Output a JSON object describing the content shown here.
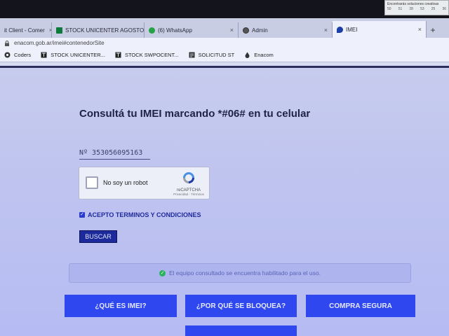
{
  "notification": {
    "text": "Encontrarás soluciones creativas",
    "numbers": [
      "50",
      "51",
      "28",
      "53",
      "25",
      "36"
    ]
  },
  "tabs": [
    {
      "label": "it Client - Comer",
      "active": false
    },
    {
      "label": "STOCK UNICENTER AGOSTO",
      "active": false
    },
    {
      "label": "(6) WhatsApp",
      "active": false
    },
    {
      "label": "Admin",
      "active": false
    },
    {
      "label": "IMEI",
      "active": true
    }
  ],
  "address": {
    "url": "enacom.gob.ar/imei#contenedorSite"
  },
  "bookmarks": [
    {
      "label": "Coders",
      "icon": "globe-icon"
    },
    {
      "label": "STOCK UNICENTER...",
      "icon": "sheet-icon"
    },
    {
      "label": "STOCK SWPOCENT...",
      "icon": "sheet-icon"
    },
    {
      "label": "SOLICITUD ST",
      "icon": "form-icon"
    },
    {
      "label": "Enacom",
      "icon": "drop-icon"
    }
  ],
  "main": {
    "title": "Consultá tu IMEI marcando *#06# en tu celular",
    "imei_value": "Nº 353056095163",
    "captcha_label": "No soy un robot",
    "captcha_brand": "reCAPTCHA",
    "captcha_links": "Privacidad - Términos",
    "terms_label": "ACEPTO TERMINOS Y CONDICIONES",
    "terms_checked": true,
    "search_label": "BUSCAR",
    "status_text": "El equipo consultado se encuentra habilitado para el uso."
  },
  "nav_buttons": {
    "what": "¿QUÉ ES IMEI?",
    "why": "¿POR QUÉ SE BLOQUEA?",
    "buy": "COMPRA SEGURA"
  },
  "colors": {
    "accent": "#2f47ee",
    "title": "#1f2245",
    "success": "#27b35a"
  }
}
